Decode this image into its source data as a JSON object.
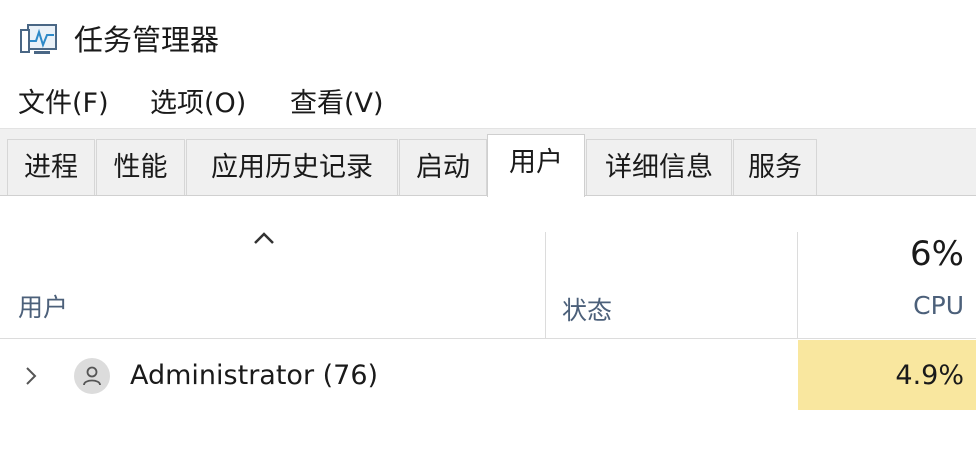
{
  "window": {
    "title": "任务管理器",
    "icon": "task-manager-icon"
  },
  "menu": {
    "items": [
      {
        "label": "文件(F)"
      },
      {
        "label": "选项(O)"
      },
      {
        "label": "查看(V)"
      }
    ]
  },
  "tabs": [
    {
      "label": "进程",
      "active": false
    },
    {
      "label": "性能",
      "active": false
    },
    {
      "label": "应用历史记录",
      "active": false
    },
    {
      "label": "启动",
      "active": false
    },
    {
      "label": "用户",
      "active": true
    },
    {
      "label": "详细信息",
      "active": false
    },
    {
      "label": "服务",
      "active": false
    }
  ],
  "table": {
    "sort_icon": "chevron-up-icon",
    "columns": {
      "user": "用户",
      "status": "状态",
      "cpu_label": "CPU",
      "cpu_total": "6%"
    },
    "rows": [
      {
        "name": "Administrator (76)",
        "status": "",
        "cpu": "4.9%",
        "expand_icon": "chevron-right-icon",
        "avatar_icon": "user-icon"
      }
    ]
  },
  "colors": {
    "cpu_highlight": "#f9e79f",
    "header_text": "#4c607a",
    "tab_background": "#f0f0f0"
  }
}
